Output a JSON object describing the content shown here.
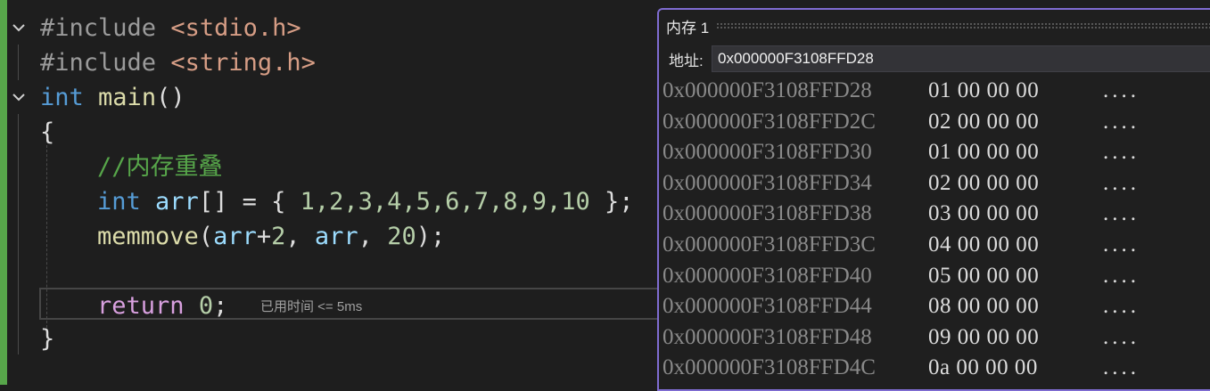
{
  "editor": {
    "lines": [
      [
        "#include ",
        "<stdio.h>"
      ],
      [
        "#include ",
        "<string.h>"
      ],
      [
        "int",
        " ",
        "main",
        "()"
      ],
      [
        "{"
      ],
      [
        "//内存重叠"
      ],
      [
        "int",
        " ",
        "arr",
        "[] = { ",
        "1,2,3,4,5,6,7,8,9,10",
        " };"
      ],
      [
        "memmove",
        "(",
        "arr",
        "+",
        "2",
        ", ",
        "arr",
        ", ",
        "20",
        ");"
      ],
      [
        ""
      ],
      [
        "return",
        " ",
        "0",
        ";"
      ],
      [
        "}"
      ]
    ],
    "hint": "已用时间 <= 5ms"
  },
  "memory": {
    "title": "内存 1",
    "address_label": "地址:",
    "address_value": "0x000000F3108FFD28",
    "rows": [
      {
        "addr": "0x000000F3108FFD28",
        "bytes": "01 00 00 00",
        "ascii": "...."
      },
      {
        "addr": "0x000000F3108FFD2C",
        "bytes": "02 00 00 00",
        "ascii": "...."
      },
      {
        "addr": "0x000000F3108FFD30",
        "bytes": "01 00 00 00",
        "ascii": "...."
      },
      {
        "addr": "0x000000F3108FFD34",
        "bytes": "02 00 00 00",
        "ascii": "...."
      },
      {
        "addr": "0x000000F3108FFD38",
        "bytes": "03 00 00 00",
        "ascii": "...."
      },
      {
        "addr": "0x000000F3108FFD3C",
        "bytes": "04 00 00 00",
        "ascii": "...."
      },
      {
        "addr": "0x000000F3108FFD40",
        "bytes": "05 00 00 00",
        "ascii": "...."
      },
      {
        "addr": "0x000000F3108FFD44",
        "bytes": "08 00 00 00",
        "ascii": "...."
      },
      {
        "addr": "0x000000F3108FFD48",
        "bytes": "09 00 00 00",
        "ascii": "...."
      },
      {
        "addr": "0x000000F3108FFD4C",
        "bytes": "0a 00 00 00",
        "ascii": "...."
      }
    ]
  },
  "colors": {
    "accent": "#7f6cd1",
    "gutter": "#57a64a"
  }
}
